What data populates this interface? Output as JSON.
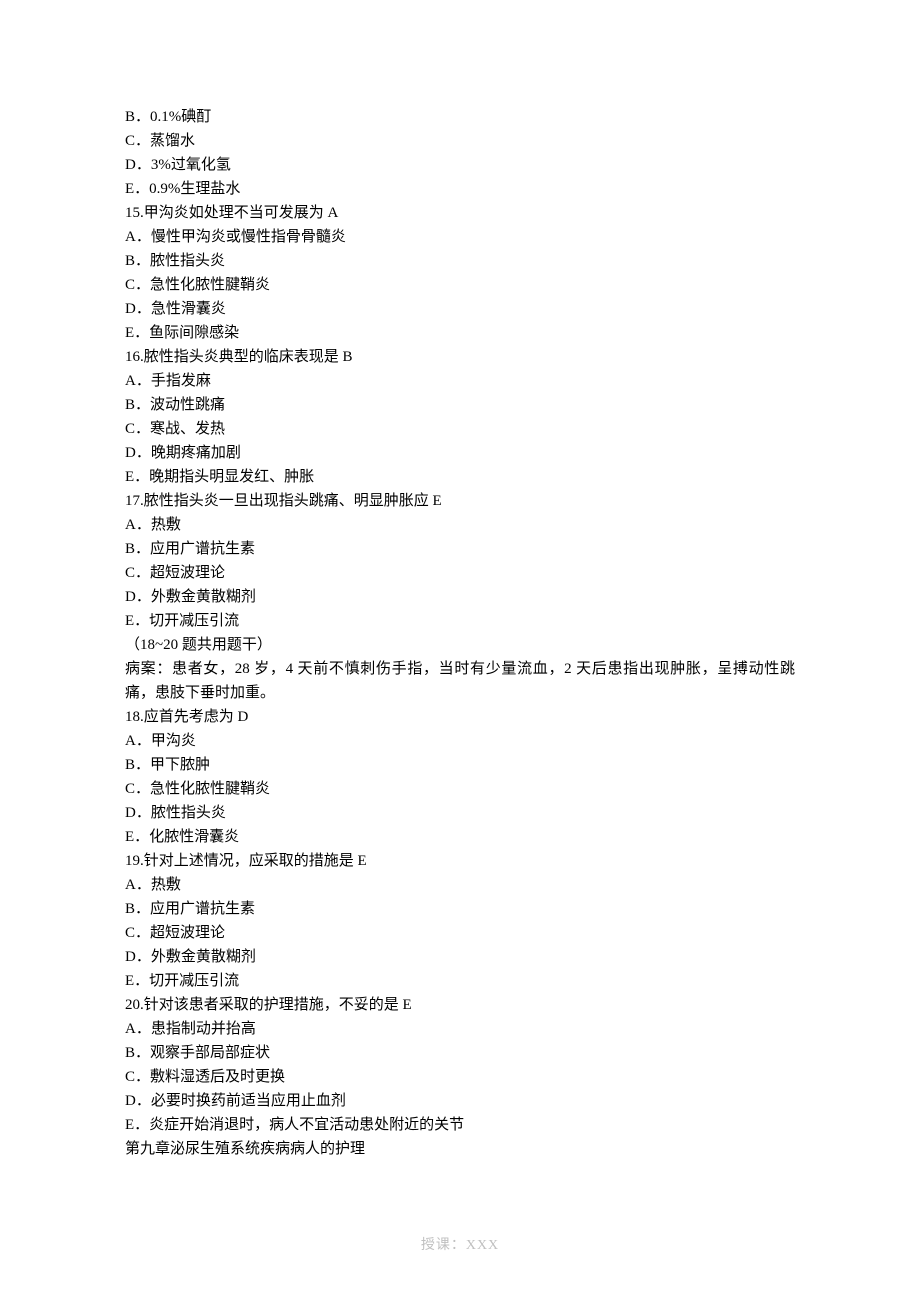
{
  "lines": [
    "B．0.1%碘酊",
    "C．蒸馏水",
    "D．3%过氧化氢",
    "E．0.9%生理盐水",
    "15.甲沟炎如处理不当可发展为 A",
    "A．慢性甲沟炎或慢性指骨骨髓炎",
    "B．脓性指头炎",
    "C．急性化脓性腱鞘炎",
    "D．急性滑囊炎",
    "E．鱼际间隙感染",
    "16.脓性指头炎典型的临床表现是 B",
    "A．手指发麻",
    "B．波动性跳痛",
    "C．寒战、发热",
    "D．晚期疼痛加剧",
    "E．晚期指头明显发红、肿胀",
    "17.脓性指头炎一旦出现指头跳痛、明显肿胀应 E",
    "A．热敷",
    "B．应用广谱抗生素",
    "C．超短波理论",
    "D．外敷金黄散糊剂",
    "E．切开减压引流",
    "（18~20 题共用题干）",
    "病案：患者女，28 岁，4 天前不慎刺伤手指，当时有少量流血，2 天后患指出现肿胀，呈搏动性跳痛，患肢下垂时加重。",
    "18.应首先考虑为 D",
    "A．甲沟炎",
    "B．甲下脓肿",
    "C．急性化脓性腱鞘炎",
    "D．脓性指头炎",
    "E．化脓性滑囊炎",
    "19.针对上述情况，应采取的措施是 E",
    "A．热敷",
    "B．应用广谱抗生素",
    "C．超短波理论",
    "D．外敷金黄散糊剂",
    "E．切开减压引流",
    "20.针对该患者采取的护理措施，不妥的是 E",
    "A．患指制动并抬高",
    "B．观察手部局部症状",
    "C．敷料湿透后及时更换",
    "D．必要时换药前适当应用止血剂",
    "E．炎症开始消退时，病人不宜活动患处附近的关节",
    "第九章泌尿生殖系统疾病病人的护理"
  ],
  "footer": "授课：XXX"
}
